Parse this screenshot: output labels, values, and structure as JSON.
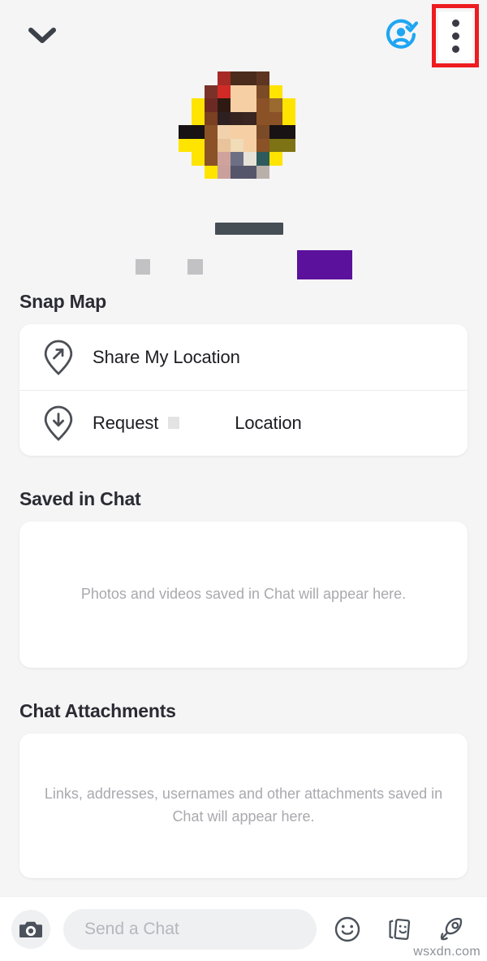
{
  "header": {
    "back_icon": "chevron-down-icon",
    "verified_friend_icon": "friend-verified-icon",
    "more_options_icon": "three-dot-menu-icon",
    "annotation_color": "#ee1c20"
  },
  "profile": {
    "avatar_label": "bitmoji-avatar",
    "display_name_redacted": "",
    "stat_badge_redacted": "",
    "avatar_pixels": [
      "#f5f5f6",
      "#f5f5f6",
      "#f5f5f6",
      "#a62a25",
      "#4a2b1c",
      "#4a2b1c",
      "#5d3521",
      "#f5f5f6",
      "#f5f5f6",
      "#f5f5f6",
      "#f5f5f6",
      "#f5f5f6",
      "#7a3228",
      "#d02a26",
      "#f6cfa4",
      "#f6cfa4",
      "#7b4a26",
      "#ffe400",
      "#f5f5f6",
      "#f5f5f6",
      "#f5f5f6",
      "#ffe400",
      "#6d2a24",
      "#2e1a12",
      "#f6cfa4",
      "#f6cfa4",
      "#8a5226",
      "#9a6a2e",
      "#ffe400",
      "#f5f5f6",
      "#f5f5f6",
      "#ffe400",
      "#7b3f22",
      "#2e2020",
      "#36221f",
      "#3a2520",
      "#8a5226",
      "#8a5226",
      "#ffe400",
      "#f5f5f6",
      "#181214",
      "#181214",
      "#8a5226",
      "#f2d2ad",
      "#f6cfa4",
      "#f6cfa4",
      "#7b4a26",
      "#181214",
      "#181214",
      "#f5f5f6",
      "#ffe400",
      "#ffe400",
      "#8a5226",
      "#e8c39b",
      "#f0dcb6",
      "#f6cfa4",
      "#8a5226",
      "#7d7314",
      "#7d7314",
      "#f5f5f6",
      "#f5f5f6",
      "#ffe400",
      "#8a5226",
      "#cfa39c",
      "#6d7085",
      "#e6e2d8",
      "#2d5a5c",
      "#ffe400",
      "#f5f5f6",
      "#f5f5f6",
      "#f5f5f6",
      "#f5f5f6",
      "#ffe400",
      "#caa09c",
      "#55566b",
      "#55566b",
      "#b9b0ab",
      "#f5f5f6",
      "#f5f5f6",
      "#f5f5f6",
      "#f5f5f6",
      "#f5f5f6",
      "#f5f5f6",
      "#f5f5f6",
      "#f5f5f6",
      "#f5f5f6",
      "#f5f5f6",
      "#f5f5f6",
      "#f5f5f6",
      "#f5f5f6"
    ]
  },
  "snap_map": {
    "title": "Snap Map",
    "rows": [
      {
        "label": "Share My Location",
        "icon": "pin-arrow-out-icon",
        "redacted": false
      },
      {
        "label_before": "Request",
        "label_after": "Location",
        "icon": "pin-arrow-down-icon",
        "redacted": true
      }
    ]
  },
  "saved_in_chat": {
    "title": "Saved in Chat",
    "empty_text": "Photos and videos saved in Chat will appear here."
  },
  "chat_attachments": {
    "title": "Chat Attachments",
    "empty_text": "Links, addresses, usernames and other attachments saved in Chat will appear here."
  },
  "chat_bar": {
    "camera_icon": "camera-icon",
    "input_placeholder": "Send a Chat",
    "input_value": "",
    "actions": [
      {
        "name": "emoji-icon"
      },
      {
        "name": "stickers-icon"
      },
      {
        "name": "rocket-icon"
      }
    ]
  },
  "watermark": {
    "text": "wsxdn.com"
  }
}
